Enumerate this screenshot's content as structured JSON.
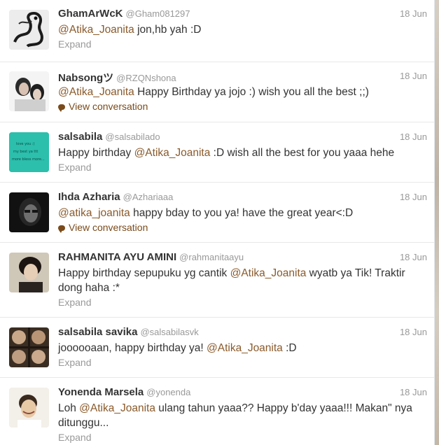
{
  "tweets": [
    {
      "fullname": "GhamArWcK",
      "username": "@Gham081297",
      "time": "18 Jun",
      "text_parts": [
        {
          "t": "@Atika_Joanita",
          "m": true
        },
        {
          "t": " jon,hb yah :D",
          "m": false
        }
      ],
      "action": "Expand",
      "action_type": "expand",
      "avatar": "dragon-avatar"
    },
    {
      "fullname": "Nabsongツ",
      "username": "@RZQNshona",
      "time": "18 Jun",
      "text_parts": [
        {
          "t": "@Atika_Joanita",
          "m": true
        },
        {
          "t": " Happy Birthday ya jojo :) wish you all the best ;;)",
          "m": false
        }
      ],
      "action": "View conversation",
      "action_type": "conversation",
      "avatar": "girls-avatar"
    },
    {
      "fullname": "salsabila",
      "username": "@salsabilado",
      "time": "18 Jun",
      "text_parts": [
        {
          "t": "Happy birthday ",
          "m": false
        },
        {
          "t": "@Atika_Joanita",
          "m": true
        },
        {
          "t": " :D wish all the best for you yaaa hehe",
          "m": false
        }
      ],
      "action": "Expand",
      "action_type": "expand",
      "avatar": "teal-note-avatar"
    },
    {
      "fullname": "Ihda Azharia",
      "username": "@Azhariaaa",
      "time": "18 Jun",
      "text_parts": [
        {
          "t": "@atika_joanita",
          "m": true
        },
        {
          "t": " happy bday to you ya! have the great year<:D",
          "m": false
        }
      ],
      "action": "View conversation",
      "action_type": "conversation",
      "avatar": "dark-portrait-avatar"
    },
    {
      "fullname": "RAHMANITA AYU AMINI",
      "username": "@rahmanitaayu",
      "time": "18 Jun",
      "text_parts": [
        {
          "t": "Happy birthday sepupuku yg cantik ",
          "m": false
        },
        {
          "t": "@Atika_Joanita",
          "m": true
        },
        {
          "t": " wyatb ya Tik! Traktir dong haha :*",
          "m": false
        }
      ],
      "action": "Expand",
      "action_type": "expand",
      "avatar": "girl-portrait-avatar"
    },
    {
      "fullname": "salsabila savika",
      "username": "@salsabilasvk",
      "time": "18 Jun",
      "text_parts": [
        {
          "t": "joooooaan, happy birthday ya! ",
          "m": false
        },
        {
          "t": "@Atika_Joanita",
          "m": true
        },
        {
          "t": " :D",
          "m": false
        }
      ],
      "action": "Expand",
      "action_type": "expand",
      "avatar": "collage-avatar"
    },
    {
      "fullname": "Yonenda Marsela",
      "username": "@yonenda",
      "time": "18 Jun",
      "text_parts": [
        {
          "t": "Loh ",
          "m": false
        },
        {
          "t": "@Atika_Joanita",
          "m": true
        },
        {
          "t": " ulang tahun yaaa?? Happy b'day yaaa!!! Makan\" nya ditunggu...",
          "m": false
        }
      ],
      "action": "Expand",
      "action_type": "expand",
      "avatar": "smiling-face-avatar"
    }
  ],
  "colors": {
    "mention": "#8a5a2b",
    "conversation": "#7a4a1a",
    "meta": "#999999",
    "text": "#333333"
  },
  "avatar_notes": {
    "teal_note_lines": [
      "love you :)",
      "my best ya ttt",
      "more bless more..."
    ]
  }
}
